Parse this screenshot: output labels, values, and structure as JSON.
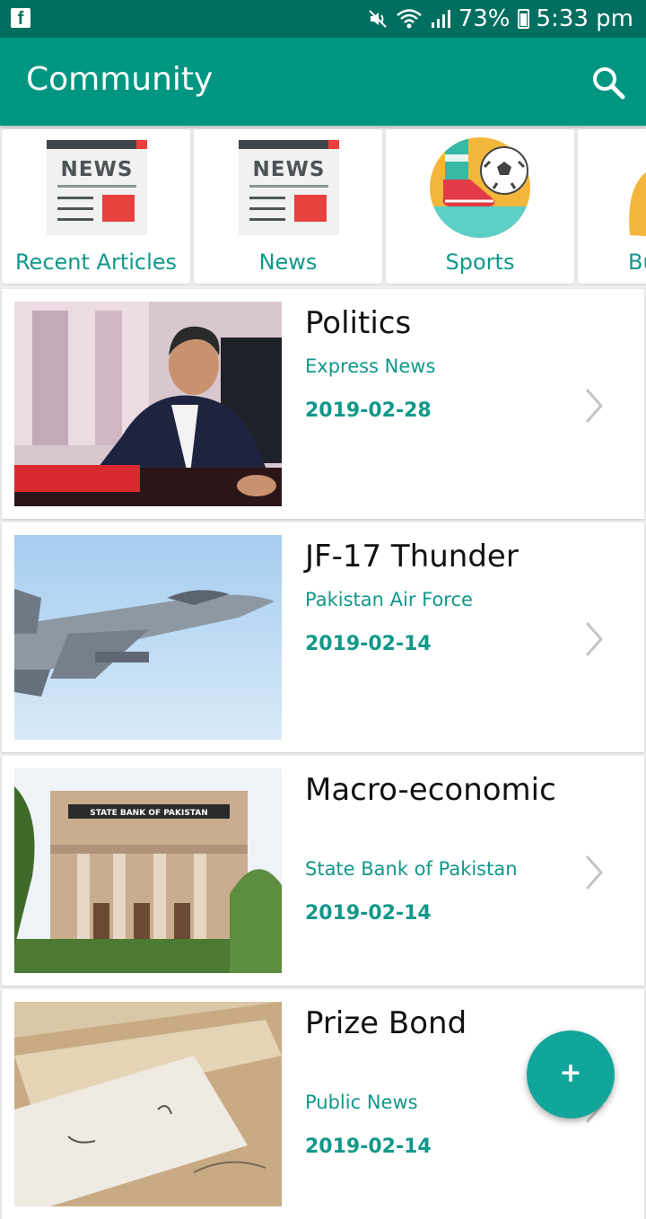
{
  "status_bar": {
    "app_icon": "f",
    "battery": "73%",
    "time": "5:33 pm",
    "icons": [
      "mute-icon",
      "wifi-icon",
      "signal-icon",
      "battery-icon"
    ]
  },
  "app_bar": {
    "title": "Community",
    "search_icon": "search-icon"
  },
  "categories": [
    {
      "label": "Recent Articles",
      "icon": "newspaper-icon"
    },
    {
      "label": "News",
      "icon": "newspaper-icon"
    },
    {
      "label": "Sports",
      "icon": "soccer-icon"
    },
    {
      "label": "Bu",
      "icon": "business-icon"
    }
  ],
  "articles": [
    {
      "title": "Politics",
      "source": "Express News",
      "date": "2019-02-28"
    },
    {
      "title": "JF-17 Thunder",
      "source": "Pakistan Air Force",
      "date": "2019-02-14"
    },
    {
      "title": "Macro-economic",
      "source": "State Bank of Pakistan",
      "date": "2019-02-14",
      "image_text": "STATE BANK OF PAKISTAN"
    },
    {
      "title": "Prize Bond",
      "source": "Public News",
      "date": "2019-02-14"
    }
  ],
  "fab": {
    "label": "+"
  },
  "colors": {
    "primary": "#009682",
    "primary_dark": "#006f60",
    "accent": "#12a59a",
    "text_accent": "#11988a"
  }
}
